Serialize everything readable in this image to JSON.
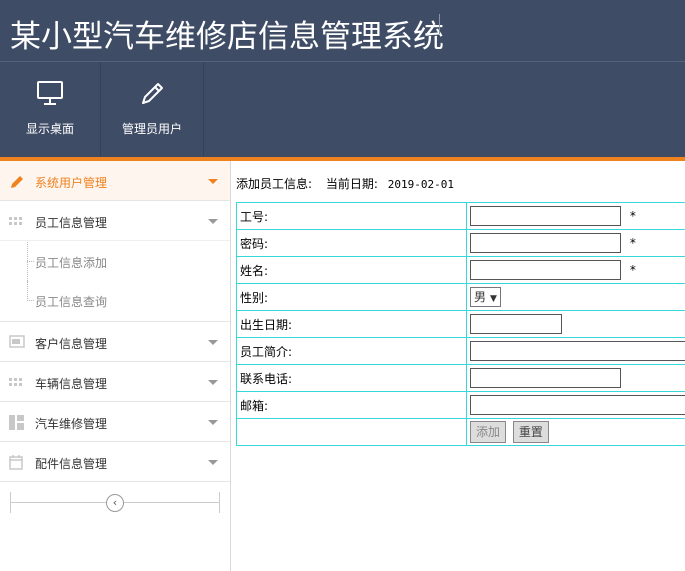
{
  "app": {
    "title": "某小型汽车维修店信息管理系统"
  },
  "toolbar": {
    "items": [
      {
        "label": "显示桌面",
        "icon": "monitor-icon"
      },
      {
        "label": "管理员用户",
        "icon": "pencil-icon"
      }
    ]
  },
  "sidebar": {
    "menus": [
      {
        "label": "系统用户管理",
        "icon": "pencil-icon",
        "active": true
      },
      {
        "label": "员工信息管理",
        "icon": "grid-icon",
        "expanded": true,
        "children": [
          {
            "label": "员工信息添加"
          },
          {
            "label": "员工信息查询"
          }
        ]
      },
      {
        "label": "客户信息管理",
        "icon": "window-icon"
      },
      {
        "label": "车辆信息管理",
        "icon": "grid-icon"
      },
      {
        "label": "汽车维修管理",
        "icon": "layout-icon"
      },
      {
        "label": "配件信息管理",
        "icon": "calendar-icon"
      }
    ],
    "collapse_glyph": "‹"
  },
  "main": {
    "heading": "添加员工信息:",
    "date_label": "当前日期:",
    "date_value": "2019-02-01",
    "form": {
      "fields": [
        {
          "label": "工号:",
          "value": "",
          "required": true
        },
        {
          "label": "密码:",
          "value": "",
          "required": true
        },
        {
          "label": "姓名:",
          "value": "",
          "required": true
        },
        {
          "label": "性别:",
          "value": "男"
        },
        {
          "label": "出生日期:",
          "value": ""
        },
        {
          "label": "员工简介:",
          "value": ""
        },
        {
          "label": "联系电话:",
          "value": ""
        },
        {
          "label": "邮箱:",
          "value": ""
        }
      ],
      "required_mark": "*",
      "submit_label": "添加",
      "reset_label": "重置"
    }
  },
  "colors": {
    "header_bg": "#3f4c66",
    "accent": "#f0811f",
    "table_border": "#38d8d8"
  }
}
